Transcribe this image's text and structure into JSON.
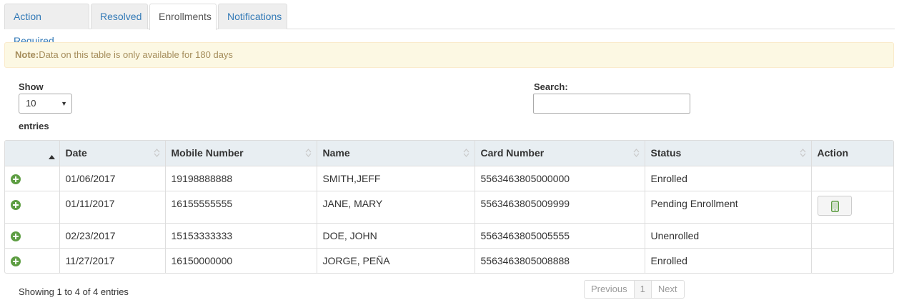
{
  "tabs": [
    {
      "label": "Action Required",
      "active": false
    },
    {
      "label": "Resolved",
      "active": false
    },
    {
      "label": "Enrollments",
      "active": true
    },
    {
      "label": "Notifications",
      "active": false
    }
  ],
  "note": {
    "prefix": "Note:",
    "text": "Data on this table is only available for 180 days"
  },
  "length_control": {
    "show_label": "Show",
    "selected": "10",
    "entries_label": "entries"
  },
  "search": {
    "label": "Search:",
    "value": ""
  },
  "table": {
    "columns": [
      "",
      "Date",
      "Mobile Number",
      "Name",
      "Card Number",
      "Status",
      "Action"
    ],
    "rows": [
      {
        "date": "01/06/2017",
        "mobile": "19198888888",
        "name": "SMITH,JEFF",
        "card": "5563463805000000",
        "status": "Enrolled",
        "action": null
      },
      {
        "date": "01/11/2017",
        "mobile": "16155555555",
        "name": "JANE, MARY",
        "card": "5563463805009999",
        "status": "Pending Enrollment",
        "action": "mobile-phone-icon"
      },
      {
        "date": "02/23/2017",
        "mobile": "15153333333",
        "name": "DOE, JOHN",
        "card": "5563463805005555",
        "status": "Unenrolled",
        "action": null
      },
      {
        "date": "11/27/2017",
        "mobile": "16150000000",
        "name": "JORGE, PEÑA",
        "card": "5563463805008888",
        "status": "Enrolled",
        "action": null
      }
    ]
  },
  "footer": {
    "info": "Showing 1 to 4 of 4 entries",
    "pagination": {
      "previous": "Previous",
      "page": "1",
      "next": "Next"
    }
  },
  "colors": {
    "link": "#337ab7",
    "note_bg": "#fcf8e3",
    "note_text": "#a58d5b",
    "header_bg": "#e8eef2",
    "expand_icon": "#5d9d42"
  }
}
